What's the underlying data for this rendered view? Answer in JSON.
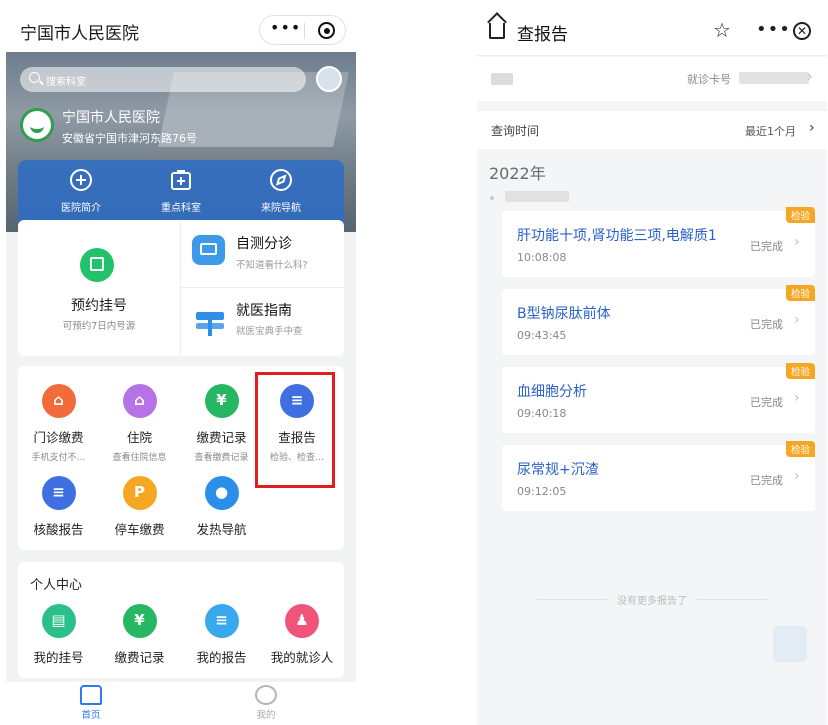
{
  "left": {
    "title": "宁国市人民医院",
    "capsule": {
      "more": "•••"
    },
    "search": {
      "placeholder": "搜索科室"
    },
    "hospital": {
      "name": "宁国市人民医院",
      "address": "安徽省宁国市津河东路76号"
    },
    "hero_items": [
      {
        "label": "医院简介",
        "icon": "plus-circle-icon"
      },
      {
        "label": "重点科室",
        "icon": "medical-box-icon"
      },
      {
        "label": "来院导航",
        "icon": "navigation-icon"
      }
    ],
    "appointment": {
      "title": "预约挂号",
      "subtitle": "可预约7日内号源"
    },
    "self_check": {
      "title": "自测分诊",
      "subtitle": "不知道看什么科?"
    },
    "guide": {
      "title": "就医指南",
      "subtitle": "就医宝典手中查"
    },
    "services": [
      {
        "label": "门诊缴费",
        "subtitle": "手机支付不…",
        "color": "#f26b3a",
        "icon": "clinic-icon",
        "glyph": "⌂"
      },
      {
        "label": "住院",
        "subtitle": "查看住院信息",
        "color": "#b673e6",
        "icon": "hospital-stay-icon",
        "glyph": "⌂"
      },
      {
        "label": "缴费记录",
        "subtitle": "查看缴费记录",
        "color": "#27b662",
        "icon": "payment-record-icon",
        "glyph": "¥"
      },
      {
        "label": "查报告",
        "subtitle": "检验、检查…",
        "color": "#3f6fe0",
        "icon": "report-icon",
        "glyph": "≡"
      },
      {
        "label": "核酸报告",
        "subtitle": "",
        "color": "#3f6fe0",
        "icon": "nucleic-report-icon",
        "glyph": "≡"
      },
      {
        "label": "停车缴费",
        "subtitle": "",
        "color": "#f5a623",
        "icon": "parking-icon",
        "glyph": "P"
      },
      {
        "label": "发热导航",
        "subtitle": "",
        "color": "#2a8fe8",
        "icon": "fever-car-icon",
        "glyph": "●"
      }
    ],
    "personal": {
      "title": "个人中心",
      "items": [
        {
          "label": "我的挂号",
          "color": "#2bc08a",
          "icon": "my-appointment-icon",
          "glyph": "▤"
        },
        {
          "label": "缴费记录",
          "color": "#27b662",
          "icon": "payment-record-icon",
          "glyph": "¥"
        },
        {
          "label": "我的报告",
          "color": "#39a8ec",
          "icon": "my-report-icon",
          "glyph": "≡"
        },
        {
          "label": "我的就诊人",
          "color": "#f0547a",
          "icon": "patients-icon",
          "glyph": "♟"
        }
      ]
    },
    "tabs": [
      {
        "label": "首页",
        "color": "#2f7be8"
      },
      {
        "label": "我的",
        "color": "#aaaaaa"
      }
    ]
  },
  "right": {
    "title": "查报告",
    "card_label": "就诊卡号",
    "query": {
      "label": "查询时间",
      "value": "最近1个月"
    },
    "year": "2022年",
    "badge": "检验",
    "status": "已完成",
    "reports": [
      {
        "name": "肝功能十项,肾功能三项,电解质1",
        "time": "10:08:08"
      },
      {
        "name": "B型钠尿肽前体",
        "time": "09:43:45"
      },
      {
        "name": "血细胞分析",
        "time": "09:40:18"
      },
      {
        "name": "尿常规+沉渣",
        "time": "09:12:05"
      }
    ],
    "no_more": "没有更多报告了"
  }
}
